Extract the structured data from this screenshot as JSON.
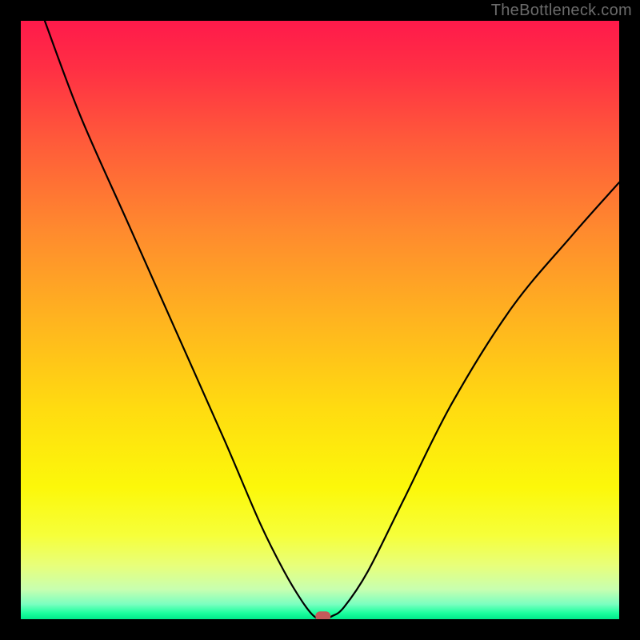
{
  "watermark": "TheBottleneck.com",
  "chart_data": {
    "type": "line",
    "title": "",
    "xlabel": "",
    "ylabel": "",
    "xlim": [
      0,
      100
    ],
    "ylim": [
      0,
      100
    ],
    "grid": false,
    "series": [
      {
        "name": "curve",
        "x": [
          4,
          10,
          18,
          26,
          34,
          40,
          44,
          47,
          49,
          50.5,
          52,
          54,
          58,
          64,
          72,
          82,
          92,
          100
        ],
        "y": [
          100,
          84,
          66,
          48,
          30,
          16,
          8,
          3,
          0.5,
          0,
          0.5,
          2,
          8,
          20,
          36,
          52,
          64,
          73
        ]
      }
    ],
    "marker": {
      "x": 50.5,
      "y": 0.5,
      "color": "#c55a5a"
    }
  }
}
